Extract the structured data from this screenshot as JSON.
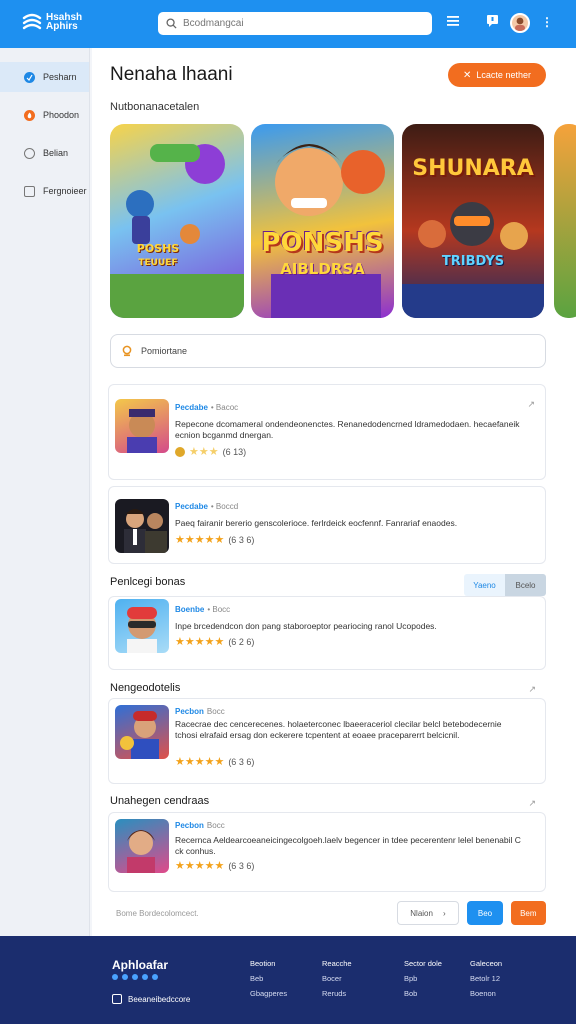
{
  "colors": {
    "brand": "#1e90f0",
    "accent": "#f26d1f",
    "footer": "#1b2d6e",
    "star": "#f3a21b"
  },
  "header": {
    "logo_line1": "Hsahsh",
    "logo_line2": "Aphirs",
    "search_placeholder": "Bcodmangcai",
    "icons": [
      "menu-icon",
      "notification-icon",
      "avatar",
      "more-icon"
    ]
  },
  "sidebar": {
    "items": [
      {
        "label": "Pesharn",
        "icon": "home-icon",
        "color": "#1e88e5"
      },
      {
        "label": "Phoodon",
        "icon": "fire-icon",
        "color": "#f26d1f"
      },
      {
        "label": "Belian",
        "icon": "gear-icon",
        "color": "#777"
      },
      {
        "label": "Fergnoieer",
        "icon": "folder-icon",
        "color": "#777"
      }
    ]
  },
  "main": {
    "title": "Nenaha lhaani",
    "cta_label": "Lcacte nether",
    "section_label": "Nutbonanacetalen",
    "carousel": [
      {
        "title": "POSHS",
        "subtitle": "TEUUEF"
      },
      {
        "title": "PONSHS",
        "subtitle": "AIBLDRSA"
      },
      {
        "title": "SHUNARA",
        "subtitle": "TRIBDYS"
      }
    ],
    "featured_search": "Pomiortane",
    "apps": [
      {
        "name": "Pecdabe",
        "sub": "• Bacoc",
        "desc": "Repecone dcomameral ondendeonenctes. Renanedodencrned ldramedodaen. hecaefaneik ecnion bcganmd dnergan.",
        "rating": "(6 13)",
        "stars": "★★★"
      },
      {
        "name": "Pecdabe",
        "sub": "• Boccd",
        "desc": "Paeq fairanir bererio genscolerioce. ferlrdeick eocfennf. Fanrariaf enaodes.",
        "rating": "(6 3 6)",
        "stars": "★★★★★"
      }
    ],
    "group1": {
      "heading": "Penlcegi bonas",
      "toggle": [
        "Yaeno",
        "Bcelo"
      ],
      "app": {
        "name": "Boenbe",
        "sub": "• Bocc",
        "desc": "Inpe brcedendcon don pang staboroeptor peariocing ranol Ucopodes.",
        "rating": "(6 2 6)",
        "stars": "★★★★★"
      }
    },
    "group2": {
      "heading": "Nengeodotelis",
      "app": {
        "name": "Pecbon",
        "sub": "Bocc",
        "desc": "Racecrae dec cencerecenes. holaeterconec lbaeeraceriol clecilar belcl betebodecernie tchosi elrafaid ersag don eckerere tcpentent at eoaee praceparerrt belcicnil.",
        "rating": "(6 3 6)",
        "stars": "★★★★★"
      }
    },
    "group3": {
      "heading": "Unahegen cendraas",
      "app": {
        "name": "Pecbon",
        "sub": "Bocc",
        "desc": "Recernca Aeldearcoeaneicingecolgoeh.laelv begencer in tdee pecerentenr lelel benenabil C ck conhus.",
        "rating": "(6 3 6)",
        "stars": "★★★★★"
      }
    },
    "comment_placeholder": "Bome Bordecolomcect.",
    "next_label": "Nlaion",
    "btn_blue": "Beo",
    "btn_orange": "Bem"
  },
  "footer": {
    "brand": "Aphloafar",
    "newsletter": "Beeaneibedccore",
    "cols": [
      [
        "Beotion",
        "Beb",
        "Gbagperes"
      ],
      [
        "Reacche",
        "Bocer",
        "Reruds"
      ],
      [
        "Sector dole",
        "Bpb",
        "Bob"
      ],
      [
        "Galeceon",
        "Betolr 12",
        "Boenon"
      ]
    ]
  }
}
